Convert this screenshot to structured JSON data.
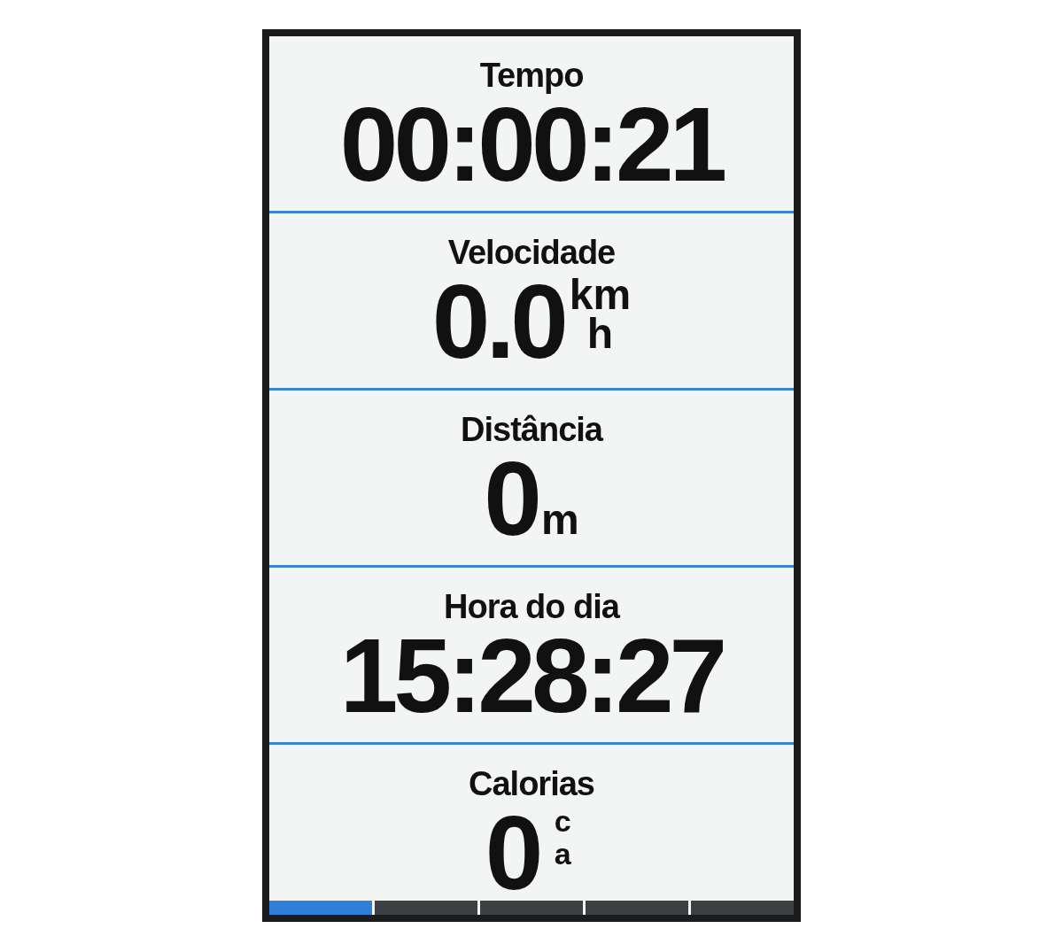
{
  "fields": [
    {
      "label": "Tempo",
      "value": "00:00:21"
    },
    {
      "label": "Velocidade",
      "value": "0.0",
      "unit": {
        "kind": "fraction",
        "top": "km",
        "bottom": "h"
      }
    },
    {
      "label": "Distância",
      "value": "0",
      "unit": {
        "kind": "inline",
        "text": "m"
      }
    },
    {
      "label": "Hora do dia",
      "value": "15:28:27"
    },
    {
      "label": "Calorias",
      "value": "0",
      "unit": {
        "kind": "vertical",
        "text": "ca"
      }
    }
  ],
  "pages": [
    {
      "selected": true
    },
    {
      "selected": false
    },
    {
      "selected": false
    },
    {
      "selected": false
    },
    {
      "selected": false
    }
  ]
}
